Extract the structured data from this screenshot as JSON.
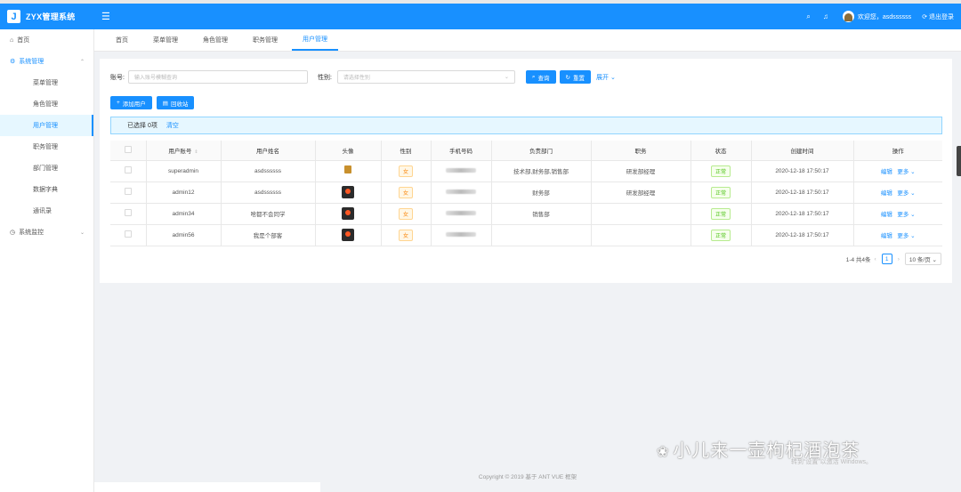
{
  "app": {
    "logo_letter": "J",
    "title": "ZYX管理系统"
  },
  "header": {
    "welcome": "欢迎您，asdssssss",
    "logout": "退出登录"
  },
  "sidebar": {
    "home": "首页",
    "system": "系统管理",
    "items": [
      "菜单管理",
      "角色管理",
      "用户管理",
      "职务管理",
      "部门管理",
      "数据字典",
      "通讯录"
    ],
    "monitor": "系统监控"
  },
  "tabs": [
    "首页",
    "菜单管理",
    "角色管理",
    "职务管理",
    "用户管理"
  ],
  "search": {
    "account_label": "账号:",
    "account_placeholder": "输入账号模糊查询",
    "gender_label": "性别:",
    "gender_placeholder": "请选择性别",
    "query": "查询",
    "reset": "重置",
    "expand": "展开"
  },
  "actions": {
    "add_user": "添加用户",
    "recycle": "回收站"
  },
  "selection": {
    "selected": "已选择 0项",
    "clear": "清空"
  },
  "table": {
    "headers": [
      "",
      "用户账号",
      "用户姓名",
      "头像",
      "性别",
      "手机号码",
      "负责部门",
      "职务",
      "状态",
      "创建时间",
      "操作"
    ],
    "rows": [
      {
        "account": "superadmin",
        "name": "asdssssss",
        "gender": "女",
        "dept": "技术部,财务部,销售部",
        "job": "研发部经理",
        "status": "正常",
        "created": "2020-12-18 17:50:17",
        "edit": "编辑",
        "more": "更多"
      },
      {
        "account": "admin12",
        "name": "asdssssss",
        "gender": "女",
        "dept": "财务部",
        "job": "研发部经理",
        "status": "正常",
        "created": "2020-12-18 17:50:17",
        "edit": "编辑",
        "more": "更多"
      },
      {
        "account": "admin34",
        "name": "啥都不会同学",
        "gender": "女",
        "dept": "销售部",
        "job": "",
        "status": "正常",
        "created": "2020-12-18 17:50:17",
        "edit": "编辑",
        "more": "更多"
      },
      {
        "account": "admin56",
        "name": "我是个部客",
        "gender": "女",
        "dept": "",
        "job": "",
        "status": "正常",
        "created": "2020-12-18 17:50:17",
        "edit": "编辑",
        "more": "更多"
      }
    ]
  },
  "pagination": {
    "total": "1-4 共4条",
    "current": "1",
    "size": "10 条/页"
  },
  "footer": "Copyright © 2019 基于 ANT VUE 框架",
  "watermark": "小儿来一壶枸杞酒泡茶",
  "activate": "转到“设置”以激活 Windows。",
  "colors": {
    "primary": "#1890ff",
    "female_tag": "#fa8c16",
    "status_ok": "#52c41a"
  }
}
